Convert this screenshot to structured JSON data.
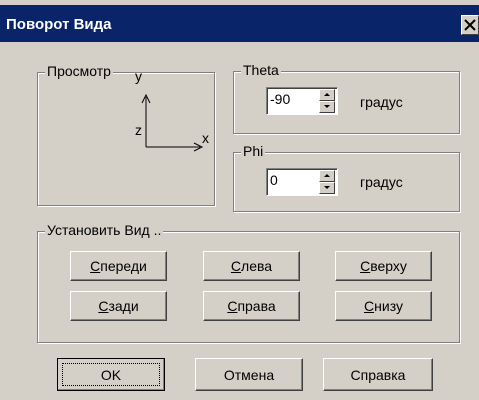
{
  "window": {
    "title": "Поворот Вида",
    "close_label": "×"
  },
  "preview": {
    "legend": "Просмотр",
    "axis_y": "y",
    "axis_z": "z",
    "axis_x": "x"
  },
  "theta": {
    "legend": "Theta",
    "value": "-90",
    "unit": "градус"
  },
  "phi": {
    "legend": "Phi",
    "value": "0",
    "unit": "градус"
  },
  "set_view": {
    "legend": "Установить Вид ..",
    "buttons": [
      {
        "accel": "С",
        "rest": "переди"
      },
      {
        "accel": "С",
        "rest": "лева"
      },
      {
        "accel": "С",
        "rest": "верху"
      },
      {
        "accel": "С",
        "rest": "зади"
      },
      {
        "accel": "С",
        "rest": "права"
      },
      {
        "accel": "С",
        "rest": "низу"
      }
    ]
  },
  "footer": {
    "ok": "OK",
    "cancel": "Отмена",
    "help": "Справка"
  }
}
